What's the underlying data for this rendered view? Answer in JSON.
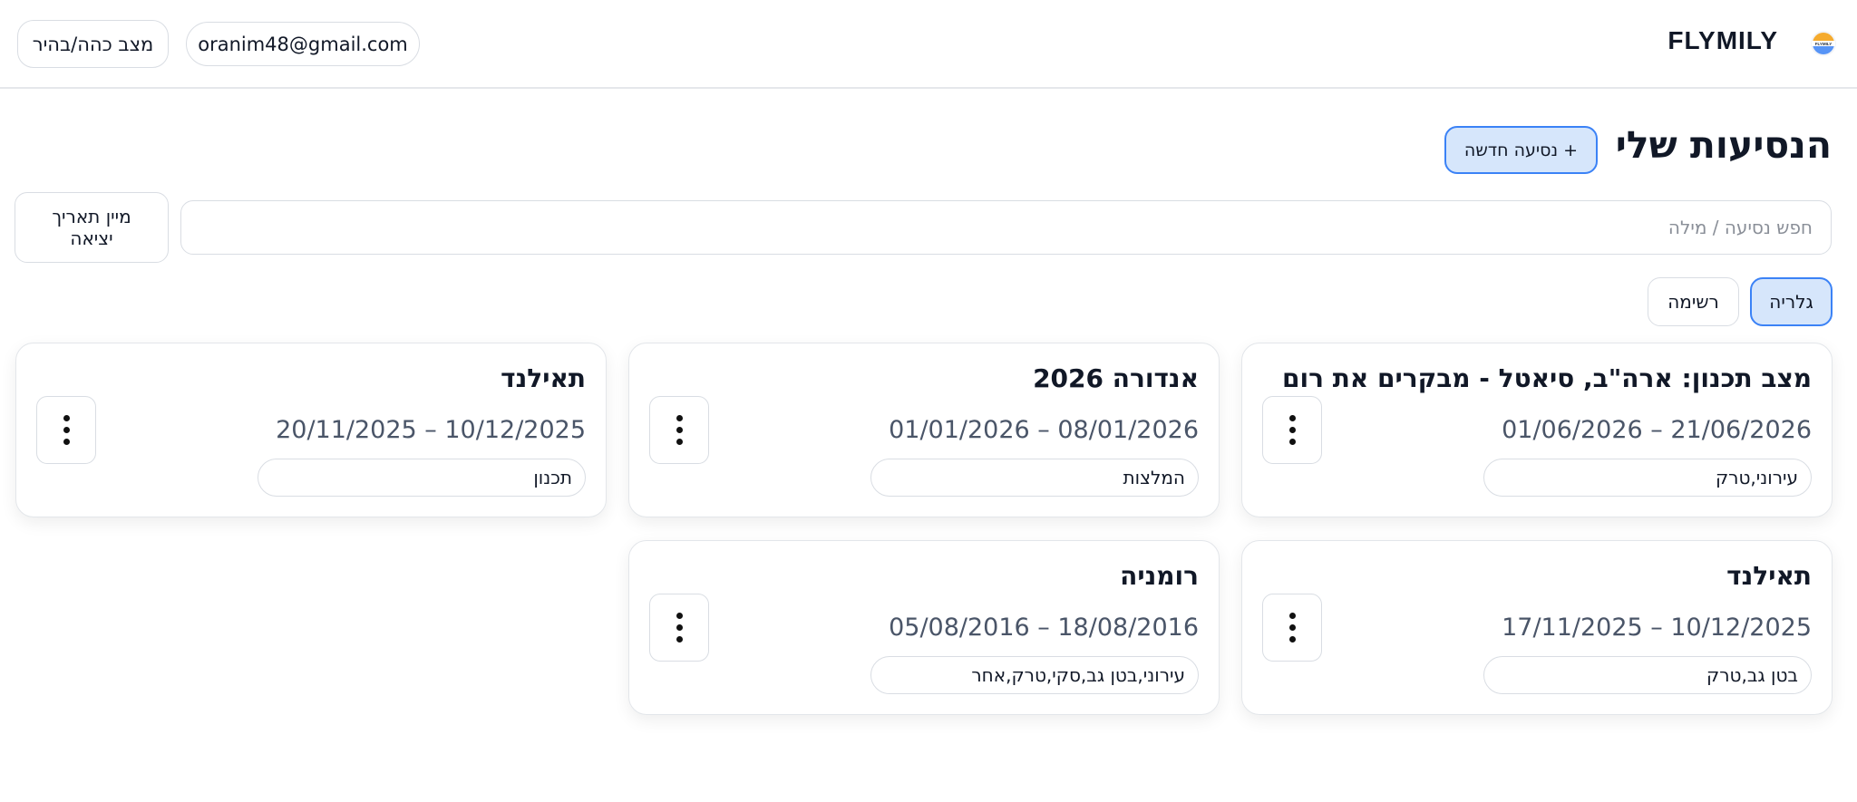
{
  "header": {
    "brand": "FLYMILY",
    "email": "oranim48@gmail.com",
    "theme_toggle": "מצב כהה/בהיר",
    "logo_text": "FLYMILY"
  },
  "main": {
    "title": "הנסיעות שלי",
    "new_trip_label": "+ נסיעה חדשה",
    "search_placeholder": "חפש נסיעה / מילה",
    "sort_label": "מיין תאריך יציאה",
    "view_gallery": "גלריה",
    "view_list": "רשימה"
  },
  "trips": [
    {
      "title": "מצב תכנון: ארה\"ב, סיאטל - מבקרים את רום",
      "dates": "01/06/2026 – 21/06/2026",
      "tags": "עירוני,טרק"
    },
    {
      "title": "אנדורה 2026",
      "dates": "01/01/2026 – 08/01/2026",
      "tags": "המלצות"
    },
    {
      "title": "תאילנד",
      "dates": "20/11/2025 – 10/12/2025",
      "tags": "תכנון"
    },
    {
      "title": "תאילנד",
      "dates": "17/11/2025 – 10/12/2025",
      "tags": "בטן גב,טרק"
    },
    {
      "title": "רומניה",
      "dates": "05/08/2016 – 18/08/2016",
      "tags": "עירוני,בטן גב,סקי,טרק,אחר"
    }
  ],
  "colors": {
    "accent_border": "#3b82f6",
    "accent_fill": "#d6e6fb",
    "date_text": "#4a5568"
  }
}
